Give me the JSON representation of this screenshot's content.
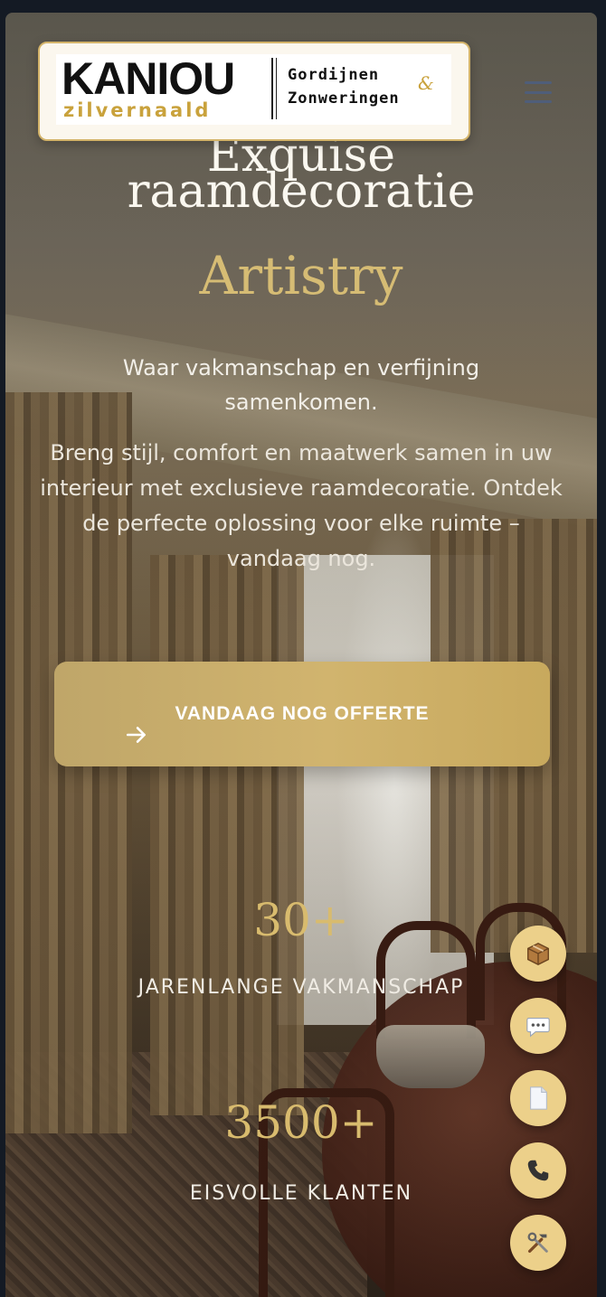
{
  "header": {
    "logo": {
      "brand": "KANIOU",
      "subbrand": "zilvernaald",
      "tagline_line1": "Gordijnen",
      "tagline_line2": "Zonweringen",
      "ampersand": "&"
    },
    "menu_icon": "hamburger-icon"
  },
  "hero": {
    "title_line1": "Exquise",
    "title_line2": "raamdecoratie",
    "accent": "Artistry",
    "lead": "Waar vakmanschap en verfijning samenkomen.",
    "body": "Breng stijl, comfort en maatwerk samen in uw interieur met exclusieve raamdecoratie. Ontdek de perfecte oplossing voor elke ruimte – vandaag nog.",
    "cta_label": "VANDAAG NOG OFFERTE"
  },
  "stats": [
    {
      "value": "30+",
      "label": "JARENLANGE VAKMANSCHAP"
    },
    {
      "value": "3500+",
      "label": "EISVOLLE KLANTEN"
    }
  ],
  "floating_actions": [
    {
      "icon": "package-icon"
    },
    {
      "icon": "chat-icon"
    },
    {
      "icon": "document-icon"
    },
    {
      "icon": "phone-icon"
    },
    {
      "icon": "tools-icon"
    }
  ],
  "colors": {
    "gold": "#d6bc74",
    "button_gold": "#d1b46e",
    "fab_gold": "#ecd08a",
    "page_bg": "#141a24"
  }
}
